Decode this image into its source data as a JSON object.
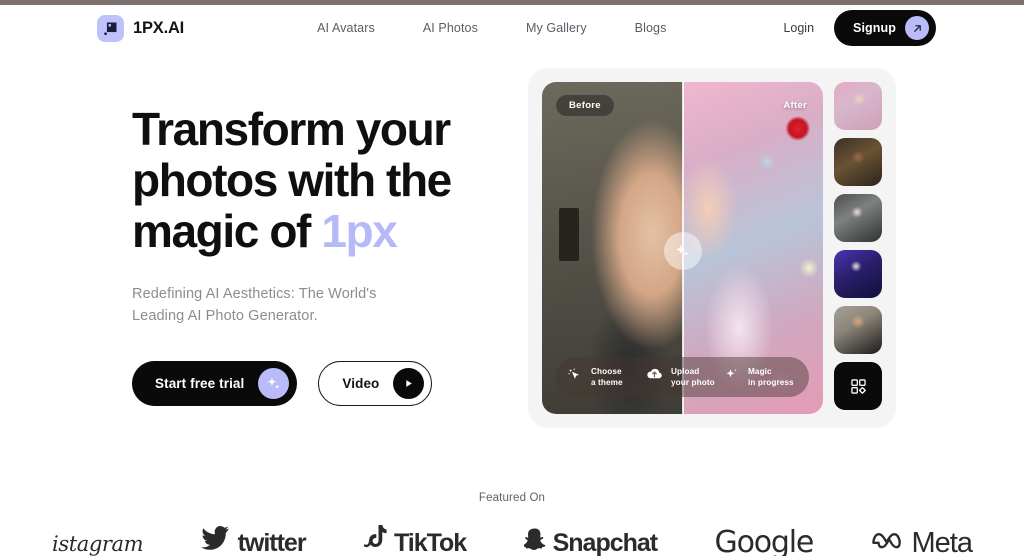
{
  "header": {
    "brand_name": "1PX.AI",
    "brand_icon": "square-logo-icon",
    "nav": [
      {
        "label": "AI Avatars"
      },
      {
        "label": "AI Photos"
      },
      {
        "label": "My Gallery"
      },
      {
        "label": "Blogs"
      }
    ],
    "login_label": "Login",
    "signup_label": "Signup",
    "signup_icon": "arrow-up-right-icon"
  },
  "hero": {
    "headline_line1": "Transform your",
    "headline_line2": "photos with the",
    "headline_line3": "magic of ",
    "headline_accent": "1px",
    "subhead_line1": "Redefining AI Aesthetics: The World's",
    "subhead_line2": "Leading AI Photo Generator.",
    "cta_primary": "Start free trial",
    "cta_primary_icon": "sparkle-icon",
    "cta_secondary": "Video",
    "cta_secondary_icon": "play-icon"
  },
  "preview": {
    "badge_before": "Before",
    "badge_after": "After",
    "divider_icon": "sparkle-icon",
    "steps": [
      {
        "icon": "cursor-sparkle-icon",
        "line1": "Choose",
        "line2": "a theme"
      },
      {
        "icon": "cloud-upload-icon",
        "line1": "Upload",
        "line2": "your photo"
      },
      {
        "icon": "sparkle-icon",
        "line1": "Magic",
        "line2": "in progress"
      }
    ],
    "thumbnails": [
      {
        "name": "thumbnail-floral-portrait"
      },
      {
        "name": "thumbnail-gold-portrait"
      },
      {
        "name": "thumbnail-bridal-portrait"
      },
      {
        "name": "thumbnail-neon-portrait"
      },
      {
        "name": "thumbnail-male-portrait"
      }
    ],
    "grid_tile_icon": "grid-view-icon"
  },
  "featured": {
    "label": "Featured On",
    "logos": [
      {
        "name": "instagram",
        "text": "istagram",
        "icon": ""
      },
      {
        "name": "twitter",
        "text": "twitter",
        "icon": "twitter-bird-icon"
      },
      {
        "name": "tiktok",
        "text": "TikTok",
        "icon": "tiktok-note-icon"
      },
      {
        "name": "snapchat",
        "text": "Snapchat",
        "icon": "snapchat-ghost-icon"
      },
      {
        "name": "google",
        "text": "Google",
        "icon": ""
      },
      {
        "name": "meta",
        "text": "Meta",
        "icon": "meta-infinity-icon"
      }
    ]
  },
  "colors": {
    "accent_purple": "#b5b9f7",
    "black": "#0a0a0a",
    "text_muted": "#8c8c95",
    "card_bg": "#f4f4f4"
  }
}
